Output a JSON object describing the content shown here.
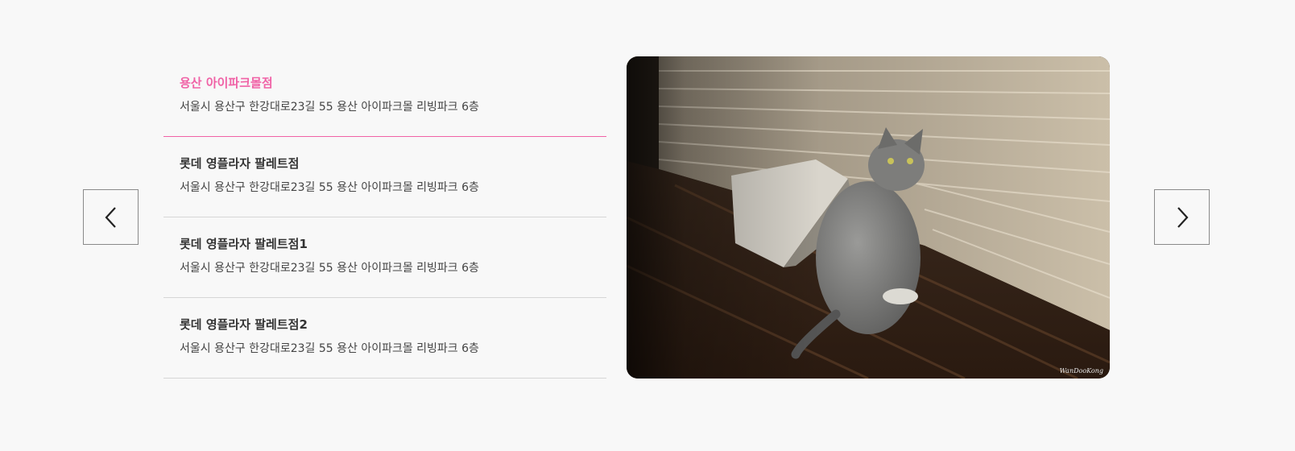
{
  "navigation": {
    "prev_icon": "chevron-left-icon",
    "next_icon": "chevron-right-icon"
  },
  "stores": [
    {
      "name": "용산 아이파크몰점",
      "address": "서울시 용산구 한강대로23길 55 용산 아이파크몰 리빙파크 6층",
      "active": true
    },
    {
      "name": "롯데 영플라자 팔레트점",
      "address": "서울시 용산구 한강대로23길 55 용산 아이파크몰 리빙파크 6층",
      "active": false
    },
    {
      "name": "롯데 영플라자 팔레트점1",
      "address": "서울시 용산구 한강대로23길 55 용산 아이파크몰 리빙파크 6층",
      "active": false
    },
    {
      "name": "롯데 영플라자 팔레트점2",
      "address": "서울시 용산구 한강대로23길 55 용산 아이파크몰 리빙파크 6층",
      "active": false
    }
  ],
  "photo": {
    "watermark": "WanDooKong"
  },
  "colors": {
    "accent": "#f062a6",
    "text": "#333333",
    "background": "#f8f8f8"
  }
}
